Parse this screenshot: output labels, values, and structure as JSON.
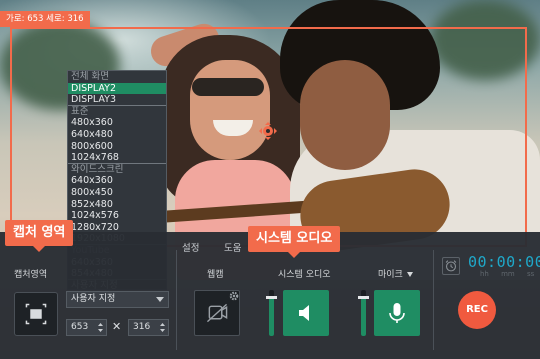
{
  "capture_frame": {
    "dimensions_text": "가로: 653  세로: 316"
  },
  "dropdown": {
    "items": [
      {
        "label": "전체 화면",
        "muted": true,
        "selected": false,
        "sep": false
      },
      {
        "label": "DISPLAY2",
        "muted": false,
        "selected": true,
        "sep": false
      },
      {
        "label": "DISPLAY3",
        "muted": false,
        "selected": false,
        "sep": true
      },
      {
        "label": "표준",
        "muted": true,
        "selected": false,
        "sep": false
      },
      {
        "label": "480x360",
        "muted": false,
        "selected": false,
        "sep": false
      },
      {
        "label": "640x480",
        "muted": false,
        "selected": false,
        "sep": false
      },
      {
        "label": "800x600",
        "muted": false,
        "selected": false,
        "sep": false
      },
      {
        "label": "1024x768",
        "muted": false,
        "selected": false,
        "sep": true
      },
      {
        "label": "와이드스크린",
        "muted": true,
        "selected": false,
        "sep": false
      },
      {
        "label": "640x360",
        "muted": false,
        "selected": false,
        "sep": false
      },
      {
        "label": "800x450",
        "muted": false,
        "selected": false,
        "sep": false
      },
      {
        "label": "852x480",
        "muted": false,
        "selected": false,
        "sep": false
      },
      {
        "label": "1024x576",
        "muted": false,
        "selected": false,
        "sep": false
      },
      {
        "label": "1280x720",
        "muted": false,
        "selected": false,
        "sep": false
      },
      {
        "label": "1920x1080",
        "muted": false,
        "selected": false,
        "sep": true
      },
      {
        "label": "YouTube",
        "muted": true,
        "selected": false,
        "sep": false
      },
      {
        "label": "640x360",
        "muted": false,
        "selected": false,
        "sep": false
      },
      {
        "label": "854x480",
        "muted": false,
        "selected": false,
        "sep": true
      },
      {
        "label": "사용자 지정",
        "muted": false,
        "selected": false,
        "sep": false
      }
    ]
  },
  "callouts": {
    "region": "캡처 영역",
    "audio": "시스템 오디오"
  },
  "toolbar": {
    "tabs": [
      "설정",
      "도움"
    ],
    "capture_area_label": "캡처영역",
    "preset_value": "사용자 지정",
    "width_value": "653",
    "height_value": "316",
    "times_symbol": "✕",
    "webcam_label": "웹캠",
    "system_audio_label": "시스템 오디오",
    "mic_label": "마이크",
    "timer": "00:00:00",
    "timer_units": "hh mm ss",
    "rec_label": "REC"
  },
  "levels": {
    "system_audio": 0.85,
    "mic": 0.85
  },
  "colors": {
    "accent": "#f26b4b",
    "green": "#1f8d63",
    "panel": "#292d33",
    "timer": "#1fa8c9",
    "rec": "#f05a3f"
  },
  "icons": {
    "move": "move-arrows-icon",
    "capture": "capture-frame-icon",
    "webcam": "webcam-off-icon",
    "gear": "gear-icon",
    "speaker": "speaker-icon",
    "mic": "microphone-icon",
    "alarm": "alarm-clock-icon"
  }
}
